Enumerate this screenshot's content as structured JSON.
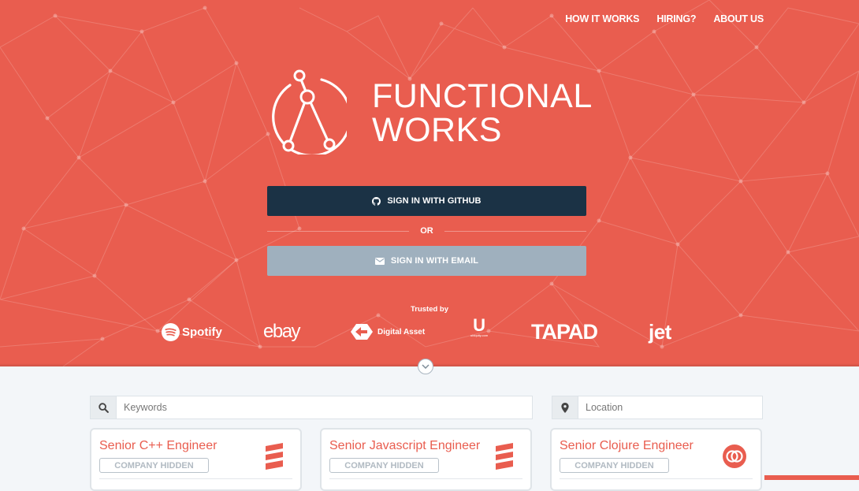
{
  "colors": {
    "hero_bg": "#e95d4f",
    "github_button": "#1b3245",
    "email_button": "#9fb0be",
    "accent": "#e95d4f"
  },
  "nav": {
    "items": [
      {
        "label": "HOW IT WORKS"
      },
      {
        "label": "HIRING?"
      },
      {
        "label": "ABOUT US"
      }
    ]
  },
  "brand": {
    "line1": "FUNCTIONAL",
    "line2": "WORKS",
    "logo_icon": "functional-works-logo-icon"
  },
  "auth": {
    "github_label": "SIGN IN WITH GITHUB",
    "github_icon": "github-icon",
    "or_label": "OR",
    "email_label": "SIGN IN WITH EMAIL",
    "email_icon": "envelope-icon"
  },
  "trusted": {
    "heading": "Trusted by",
    "logos": [
      {
        "name": "Spotify",
        "icon": "spotify-icon"
      },
      {
        "name": "ebay"
      },
      {
        "name": "Digital Asset",
        "icon": "digital-asset-icon"
      },
      {
        "name": "U",
        "sub": "ubiquity.com"
      },
      {
        "name": "TAPAD"
      },
      {
        "name": "jet"
      }
    ]
  },
  "scroll": {
    "icon": "chevron-down-icon"
  },
  "search": {
    "keywords_placeholder": "Keywords",
    "keywords_icon": "search-icon",
    "location_placeholder": "Location",
    "location_icon": "map-pin-icon"
  },
  "jobs": [
    {
      "title": "Senior C++ Engineer",
      "badge": "COMPANY HIDDEN",
      "logo_icon": "scala-logo-icon"
    },
    {
      "title": "Senior Javascript Engineer",
      "badge": "COMPANY HIDDEN",
      "logo_icon": "scala-logo-icon"
    },
    {
      "title": "Senior Clojure Engineer",
      "badge": "COMPANY HIDDEN",
      "logo_icon": "rings-logo-icon"
    }
  ]
}
